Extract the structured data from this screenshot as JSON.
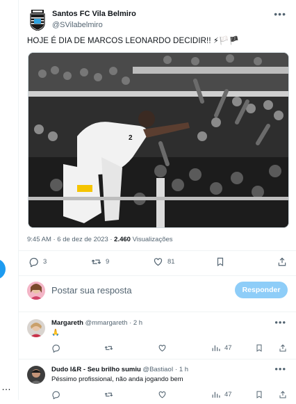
{
  "post": {
    "author_name": "Santos FC Vila Belmiro",
    "author_handle": "@SVilabelmiro",
    "text": "HOJE É DIA DE MARCOS LEONARDO DECIDIR!! ⚡🏳️🏴",
    "time": "9:45 AM · 6 de dez de 2023 · ",
    "views_count": "2.460",
    "views_label": " Visualizações",
    "stats": {
      "replies": "3",
      "reposts": "9",
      "likes": "81"
    },
    "more_icon": "more-dots-icon",
    "logo": "santos-crest"
  },
  "reply": {
    "placeholder": "Postar sua resposta",
    "button_label": "Responder"
  },
  "comments": [
    {
      "name": "Margareth",
      "handle": "@mmargareth",
      "time": " · 2 h",
      "text": "🙏",
      "stats": {
        "replies": "",
        "reposts": "",
        "likes": "",
        "views": "47"
      }
    },
    {
      "name": "Dudo I&R - Seu brilho sumiu",
      "handle": "@BastiaoI",
      "time": " · 1 h",
      "text": "Péssimo profissional, não anda jogando bem",
      "stats": {
        "replies": "",
        "reposts": "",
        "likes": "",
        "views": "47"
      }
    }
  ],
  "colors": {
    "accent": "#1d9bf0",
    "button_disabled": "#8ecdf8",
    "muted": "#536471"
  }
}
